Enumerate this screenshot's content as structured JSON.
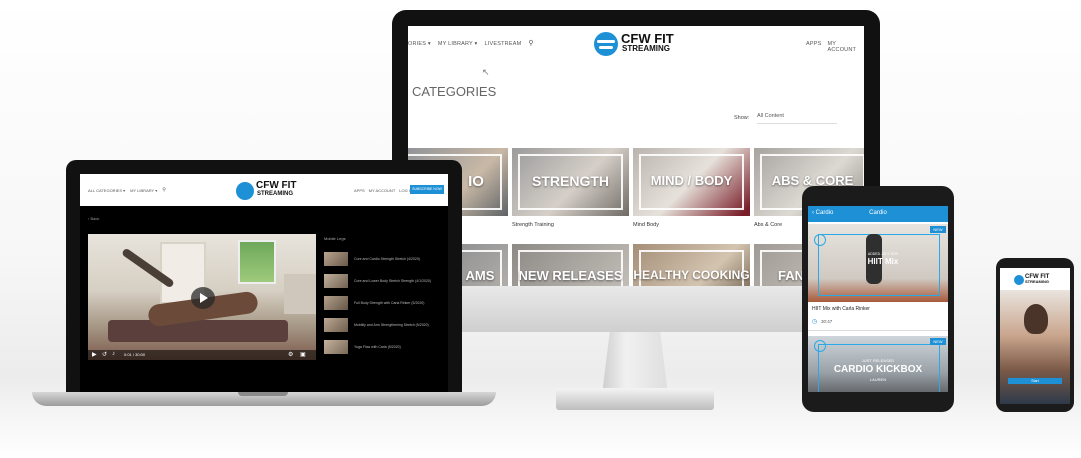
{
  "desktop": {
    "nav_left": [
      "ORIES ▾",
      "MY LIBRARY ▾",
      "LIVESTREAM"
    ],
    "nav_right": [
      "APPS",
      "MY ACCOUNT"
    ],
    "logo_line1": "CFW FIT",
    "logo_line2": "STREAMING",
    "page_title": "CATEGORIES",
    "show_label": "Show:",
    "show_value": "All Content",
    "tiles_row1": [
      {
        "label": "IO",
        "caption": ""
      },
      {
        "label": "STRENGTH",
        "caption": "Strength Training"
      },
      {
        "label": "MIND / BODY",
        "caption": "Mind Body"
      },
      {
        "label": "ABS & CORE",
        "caption": "Abs & Core"
      }
    ],
    "tiles_row2": [
      {
        "label": "AMS"
      },
      {
        "label": "NEW RELEASES"
      },
      {
        "label": "HEALTHY COOKING"
      },
      {
        "label": "FAN"
      }
    ],
    "icons": {
      "search": "search-icon",
      "cursor": "cursor-icon"
    }
  },
  "laptop": {
    "nav_left": [
      "ALL CATEGORIES ▾",
      "MY LIBRARY ▾"
    ],
    "nav_right": [
      "APPS",
      "MY ACCOUNT",
      "LOG OUT"
    ],
    "cta": "SUBSCRIBE NOW",
    "logo_line1": "CFW FIT",
    "logo_line2": "STREAMING",
    "back": "‹ Back",
    "playlist_header": "Mobile Legs",
    "playlist": [
      "Core and Cardio Strength Stretch (4/2020)",
      "Core and Lower Body Stretch Strength (4/1/2020)",
      "Full Body Strength with Carla Rinker (5/2020)",
      "Mobility and Arm Strengthening Stretch (5/2020)",
      "Yoga Flow with Carla (5/2020)"
    ],
    "player_time": "0:01 / 30:00"
  },
  "tablet": {
    "back": "‹ Cardio",
    "title": "Cardio",
    "card1": {
      "badge": "NEW",
      "overlay_small": "ADDED JULY 2020",
      "overlay_big": "HIIT Mix",
      "title": "HIIT Mix with Carla Rinker",
      "duration": "30:47"
    },
    "card2": {
      "badge": "NEW",
      "overlay_small": "JUST RELEASED",
      "overlay_big": "CARDIO KICKBOX",
      "overlay_name": "LAUREN"
    }
  },
  "phone": {
    "logo_line1": "CFW FIT",
    "logo_line2": "STREAMING",
    "cta": "Start"
  },
  "colors": {
    "brand_blue": "#1e90d6",
    "screen_black": "#111111"
  }
}
